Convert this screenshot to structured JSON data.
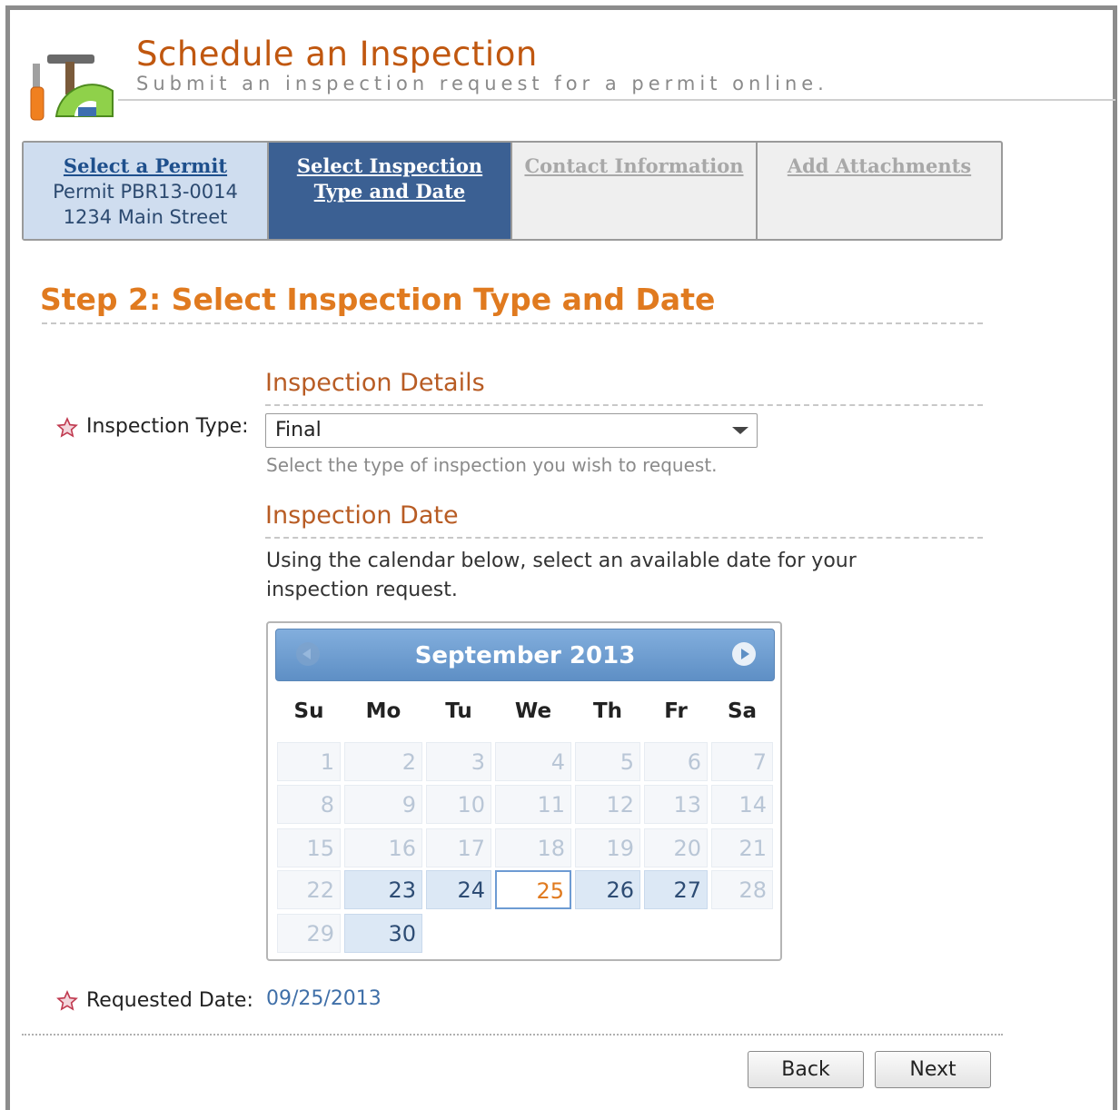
{
  "header": {
    "title": "Schedule an Inspection",
    "subtitle": "Submit an inspection request for a permit online.",
    "logo_icon": "tools-icon"
  },
  "wizard": {
    "steps": [
      {
        "label": "Select a Permit",
        "lines": [
          "Permit PBR13-0014",
          "1234 Main Street"
        ],
        "state": "completed"
      },
      {
        "label_lines": [
          "Select Inspection",
          "Type and Date"
        ],
        "state": "current"
      },
      {
        "label": "Contact Information",
        "state": "disabled"
      },
      {
        "label": "Add Attachments",
        "state": "disabled"
      }
    ]
  },
  "step_heading": "Step 2: Select Inspection Type and Date",
  "details": {
    "section_title": "Inspection Details",
    "type_label": "Inspection Type:",
    "type_value": "Final",
    "type_hint": "Select the type of inspection you wish to request."
  },
  "date_section": {
    "section_title": "Inspection Date",
    "instructions": "Using the calendar below, select an available date for your inspection request."
  },
  "calendar": {
    "month_title": "September 2013",
    "days_of_week": [
      "Su",
      "Mo",
      "Tu",
      "We",
      "Th",
      "Fr",
      "Sa"
    ],
    "first_weekday_index": 0,
    "days_in_month": 30,
    "available_days": [
      23,
      24,
      25,
      26,
      27,
      30
    ],
    "selected_day": 25,
    "colors": {
      "header": "#6b9bd0",
      "selected_text": "#e07a1f",
      "available_bg": "#dce8f5"
    }
  },
  "requested": {
    "label": "Requested Date:",
    "value": "09/25/2013"
  },
  "buttons": {
    "back": "Back",
    "next": "Next"
  },
  "colors": {
    "accent_orange": "#e07a1f",
    "nav_active": "#3b6093",
    "title_brown": "#c0570f"
  }
}
